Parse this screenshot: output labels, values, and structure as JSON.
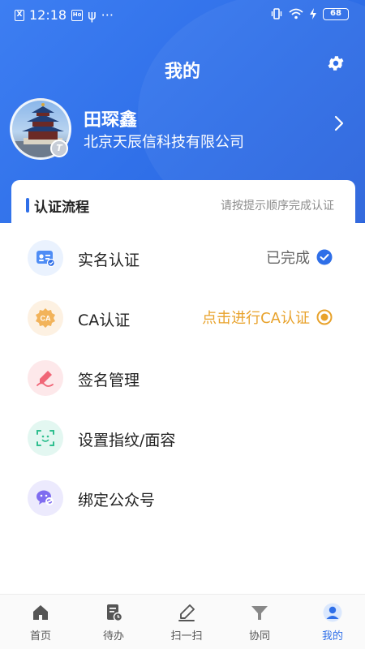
{
  "status_bar": {
    "time": "12:18",
    "ind1": "X",
    "ind2": "Ho",
    "usb": "ψ",
    "dots": "···",
    "battery": "68"
  },
  "header": {
    "title": "我的"
  },
  "profile": {
    "name": "田琛鑫",
    "company": "北京天辰信科技有限公司",
    "badge": "T"
  },
  "card": {
    "title": "认证流程",
    "hint": "请按提示顺序完成认证"
  },
  "rows": [
    {
      "label": "实名认证",
      "status": "已完成",
      "status_type": "done",
      "icon": "id-card-icon"
    },
    {
      "label": "CA认证",
      "status": "点击进行CA认证",
      "status_type": "action",
      "icon": "ca-badge-icon",
      "icon_text": "CA"
    },
    {
      "label": "签名管理",
      "icon": "signature-icon"
    },
    {
      "label": "设置指纹/面容",
      "icon": "face-scan-icon"
    },
    {
      "label": "绑定公众号",
      "icon": "wechat-icon"
    }
  ],
  "tabs": [
    {
      "label": "首页",
      "icon": "home-icon"
    },
    {
      "label": "待办",
      "icon": "todo-icon"
    },
    {
      "label": "扫一扫",
      "icon": "scan-icon"
    },
    {
      "label": "协同",
      "icon": "collaborate-icon"
    },
    {
      "label": "我的",
      "icon": "profile-icon",
      "active": true
    }
  ],
  "colors": {
    "brand": "#2f6fe8",
    "accent_orange": "#e8a22b",
    "done_check": "#2f6fe8"
  }
}
